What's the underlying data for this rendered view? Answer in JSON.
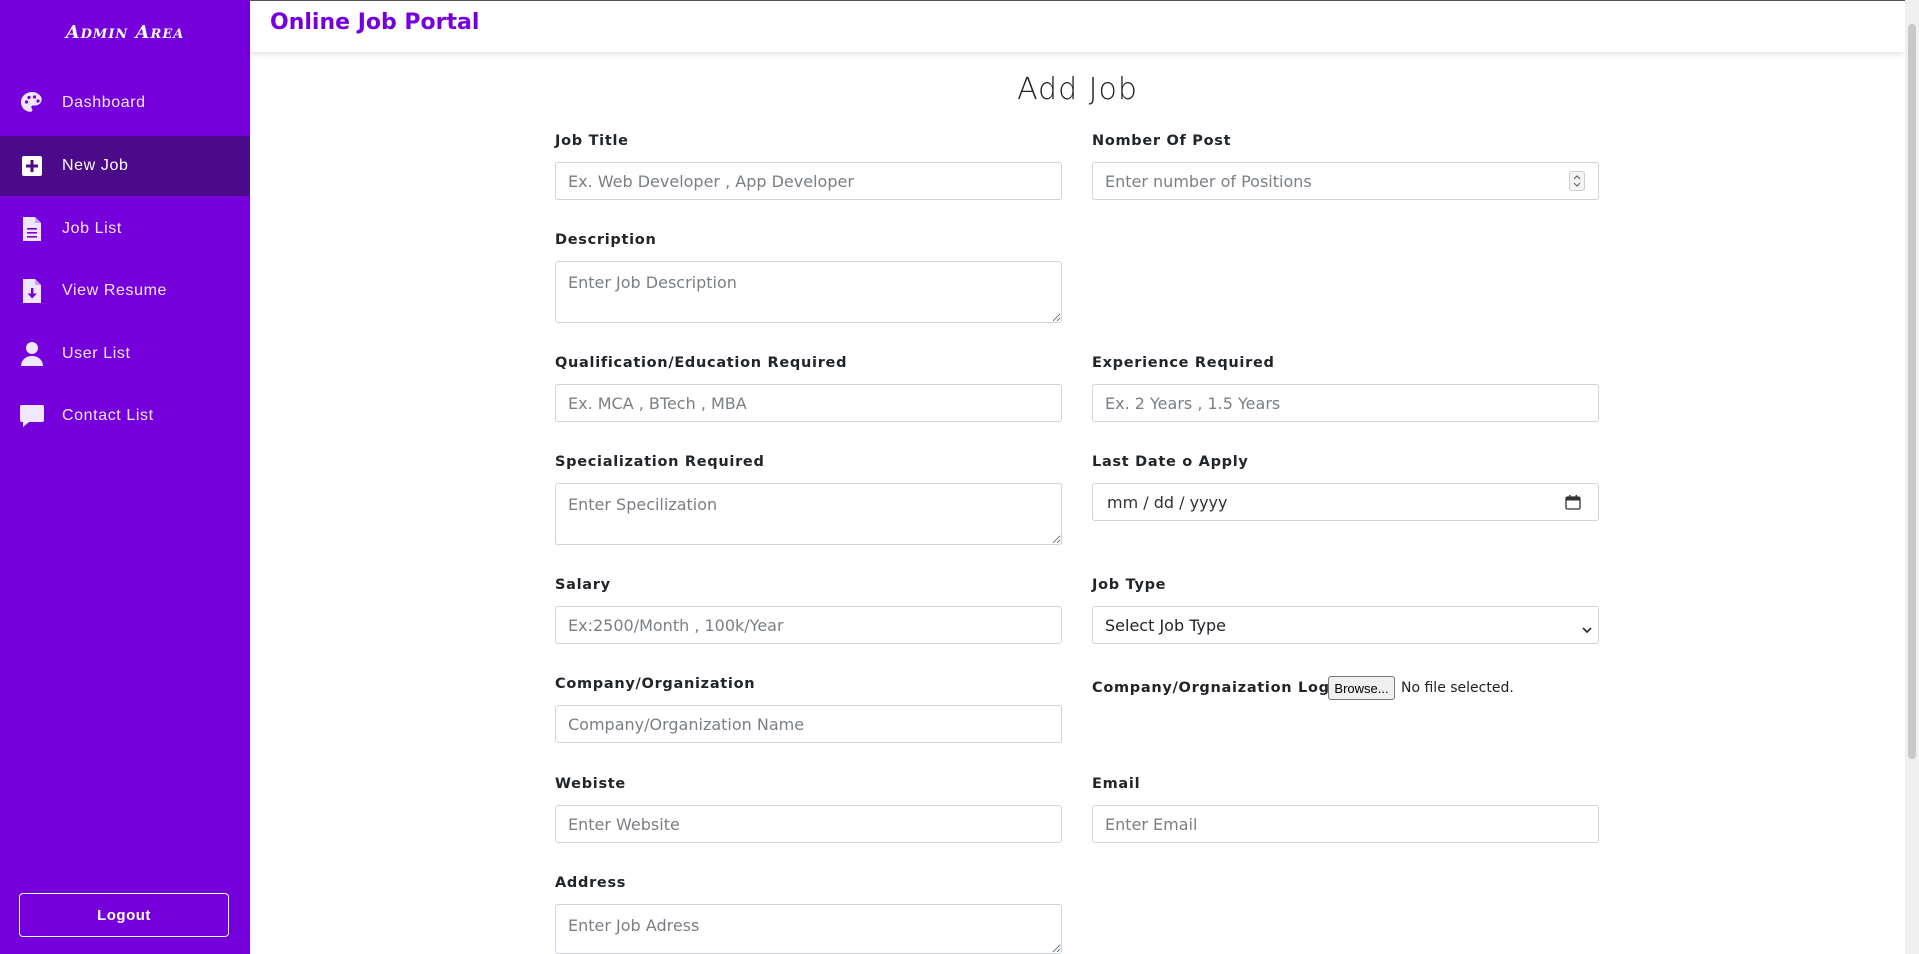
{
  "sidebar": {
    "brand": "Admin Area",
    "items": [
      {
        "label": "Dashboard",
        "icon": "palette-icon"
      },
      {
        "label": "New Job",
        "icon": "plus-square-icon"
      },
      {
        "label": "Job List",
        "icon": "document-icon"
      },
      {
        "label": "View Resume",
        "icon": "file-download-icon"
      },
      {
        "label": "User List",
        "icon": "user-icon"
      },
      {
        "label": "Contact List",
        "icon": "chat-icon"
      }
    ],
    "active_item": "New Job",
    "logout_label": "Logout"
  },
  "header": {
    "title": "Online Job Portal"
  },
  "form": {
    "heading": "Add Job",
    "job_title": {
      "label": "Job Title",
      "placeholder": "Ex. Web Developer , App Developer"
    },
    "number_of_post": {
      "label": "Nomber Of Post",
      "placeholder": "Enter number of Positions"
    },
    "description": {
      "label": "Description",
      "placeholder": "Enter Job Description"
    },
    "qualification": {
      "label": "Qualification/Education Required",
      "placeholder": "Ex. MCA , BTech , MBA"
    },
    "experience": {
      "label": "Experience Required",
      "placeholder": "Ex. 2 Years , 1.5 Years"
    },
    "specialization": {
      "label": "Specialization Required",
      "placeholder": "Enter Specilization"
    },
    "last_date": {
      "label": "Last Date o Apply",
      "value": "mm / dd / yyyy"
    },
    "salary": {
      "label": "Salary",
      "placeholder": "Ex:2500/Month , 100k/Year"
    },
    "job_type": {
      "label": "Job Type",
      "selected": "Select Job Type"
    },
    "company": {
      "label": "Company/Organization",
      "placeholder": "Company/Organization Name"
    },
    "company_logo": {
      "label": "Company/Orgnaization Logo",
      "button": "Browse...",
      "status": "No file selected."
    },
    "website": {
      "label": "Webiste",
      "placeholder": "Enter Website"
    },
    "email": {
      "label": "Email",
      "placeholder": "Enter Email"
    },
    "address": {
      "label": "Address",
      "placeholder": "Enter Job Adress"
    }
  },
  "colors": {
    "accent": "#7600dc",
    "active_nav": "#4a0a8a"
  }
}
